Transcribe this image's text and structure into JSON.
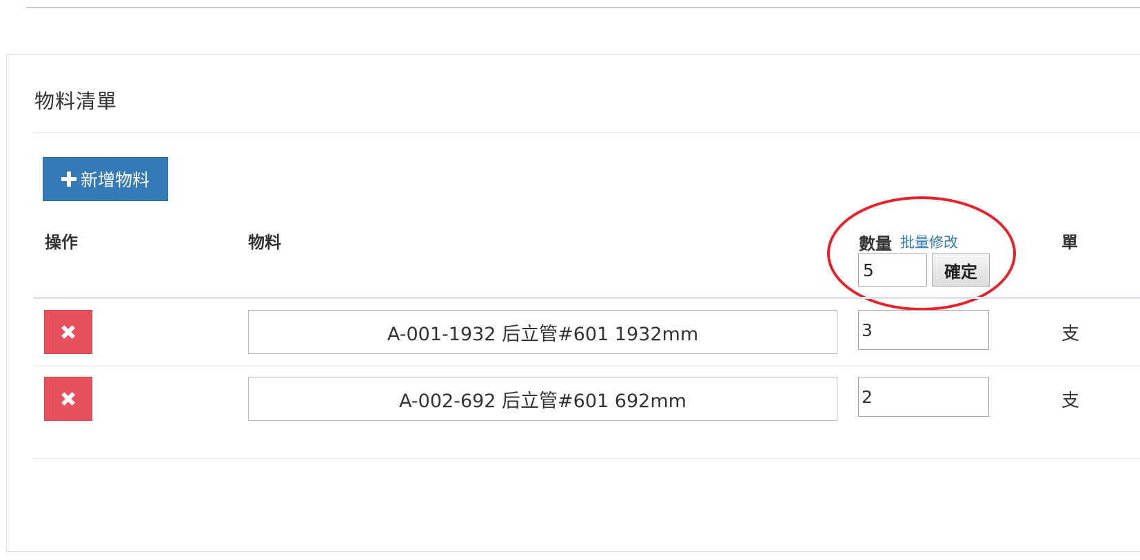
{
  "panel": {
    "title": "物料清單",
    "add_button_label": "新增物料"
  },
  "table": {
    "headers": {
      "operation": "操作",
      "material": "物料",
      "quantity": "數量",
      "unit": "單"
    },
    "batch_edit_label": "批量修改",
    "batch_quantity_value": "5",
    "confirm_label": "確定",
    "rows": [
      {
        "material": "A-001-1932 后立管#601 1932mm",
        "quantity": "3",
        "unit": "支"
      },
      {
        "material": "A-002-692 后立管#601 692mm",
        "quantity": "2",
        "unit": "支"
      }
    ]
  },
  "colors": {
    "primary": "#337ab7",
    "danger": "#e9505e",
    "annotation": "#e8222b"
  },
  "icons": {
    "add": "plus-icon",
    "delete": "close-icon"
  }
}
